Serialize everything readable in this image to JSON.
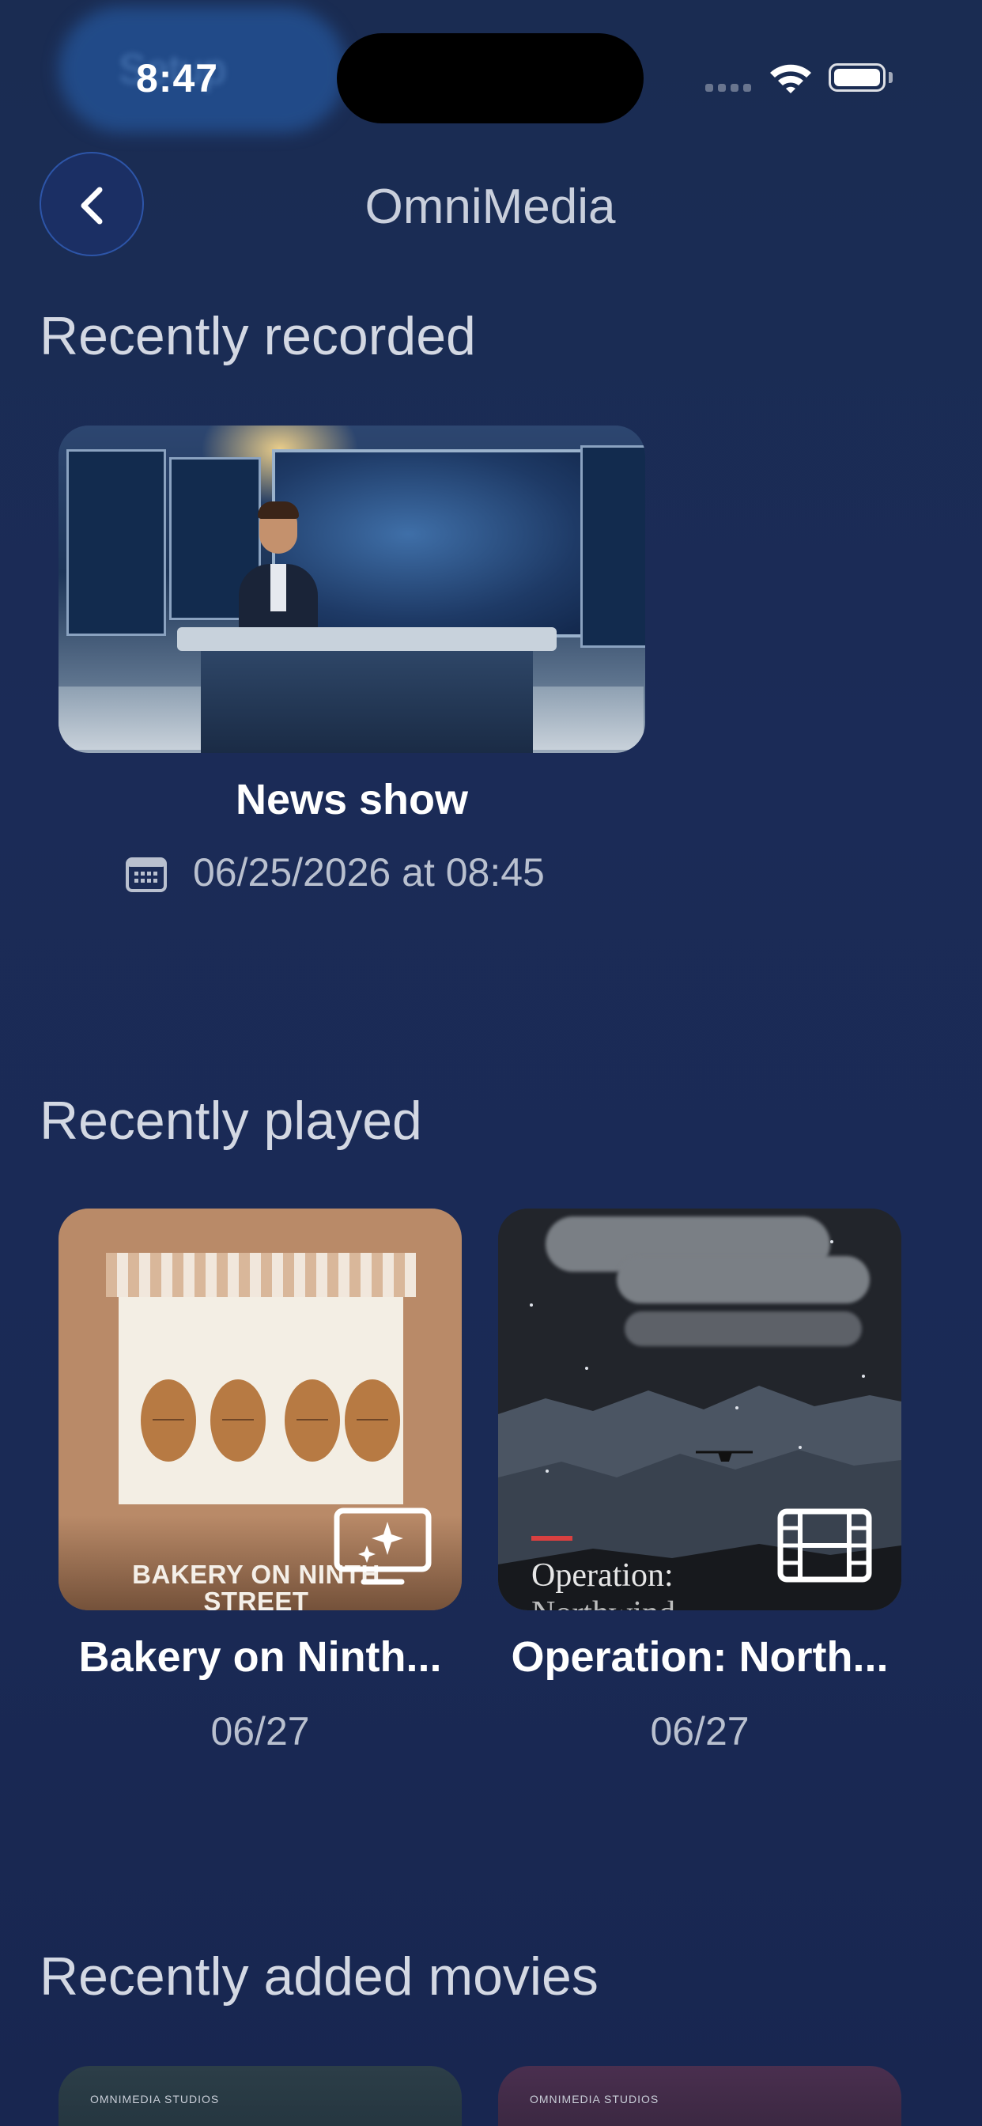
{
  "status_bar": {
    "time": "8:47",
    "ghost_label": "Setup",
    "signal_icon": "cellular-signal-icon",
    "wifi_icon": "wifi-icon",
    "battery_icon": "battery-icon"
  },
  "nav": {
    "back_icon": "chevron-left-icon",
    "title": "OmniMedia"
  },
  "sections": {
    "recently_recorded": {
      "title": "Recently recorded",
      "items": [
        {
          "title": "News show",
          "date_icon": "calendar-icon",
          "date": "06/25/2026 at 08:45"
        }
      ]
    },
    "recently_played": {
      "title": "Recently played",
      "items": [
        {
          "title": "Bakery on Ninth...",
          "thumb_caption_1": "BAKERY ON NINTH",
          "thumb_caption_2": "STREET",
          "type_icon": "tv-sparkles-icon",
          "date": "06/27"
        },
        {
          "title": "Operation: North...",
          "thumb_caption_1": "Operation:",
          "thumb_caption_2": "Northwind",
          "type_icon": "film-icon",
          "date": "06/27"
        }
      ]
    },
    "recently_added_movies": {
      "title": "Recently added movies",
      "items": [
        {
          "studio": "OMNIMEDIA STUDIOS"
        },
        {
          "studio": "OMNIMEDIA STUDIOS"
        }
      ]
    }
  },
  "colors": {
    "background": "#1b2b57",
    "back_button": "#1b2f64",
    "back_button_border": "#2d55a8"
  }
}
